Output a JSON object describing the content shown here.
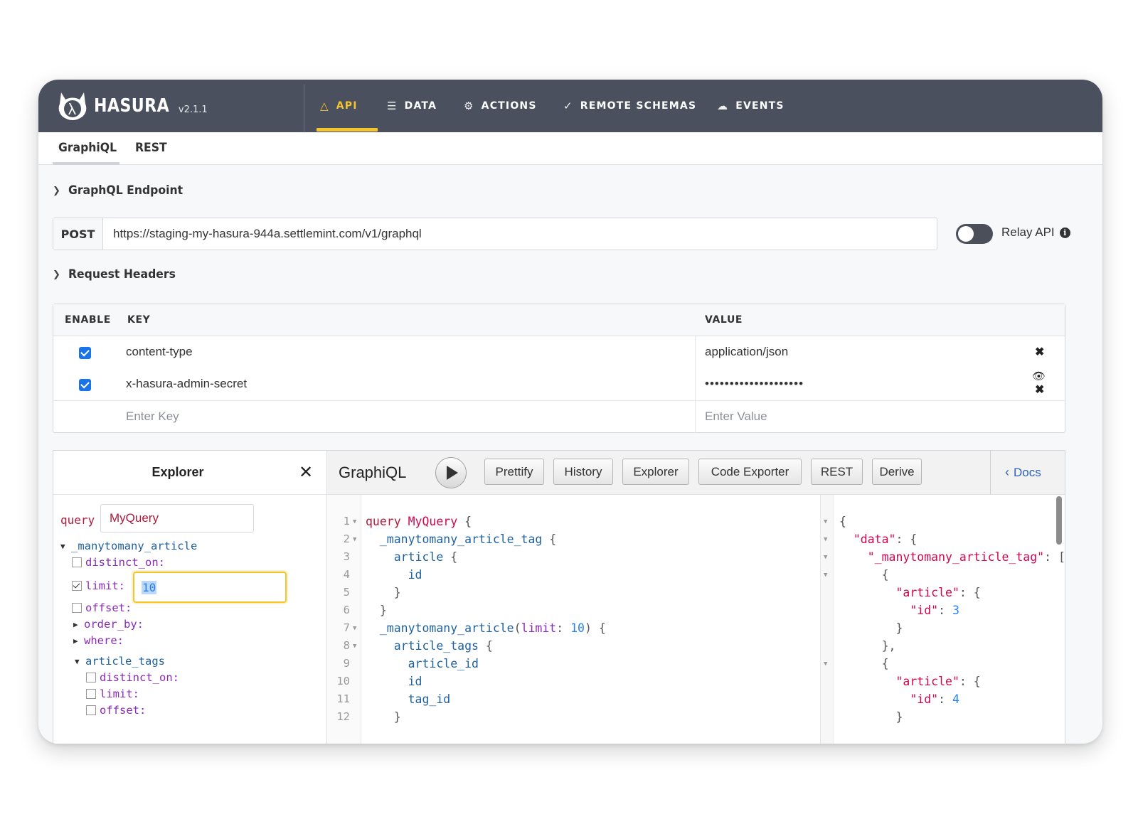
{
  "brand": {
    "name": "HASURA",
    "version": "v2.1.1"
  },
  "nav": [
    {
      "label": "API",
      "icon": "flask-icon",
      "active": true
    },
    {
      "label": "DATA",
      "icon": "database-icon",
      "active": false
    },
    {
      "label": "ACTIONS",
      "icon": "gears-icon",
      "active": false
    },
    {
      "label": "REMOTE SCHEMAS",
      "icon": "plug-icon",
      "active": false
    },
    {
      "label": "EVENTS",
      "icon": "cloud-icon",
      "active": false
    }
  ],
  "subtabs": [
    {
      "label": "GraphiQL",
      "active": true
    },
    {
      "label": "REST",
      "active": false
    }
  ],
  "endpoint": {
    "section_title": "GraphQL Endpoint",
    "method": "POST",
    "url": "https://staging-my-hasura-944a.settlemint.com/v1/graphql",
    "relay_label": "Relay API",
    "relay_enabled": false
  },
  "headers": {
    "section_title": "Request Headers",
    "columns": {
      "enable": "ENABLE",
      "key": "KEY",
      "value": "VALUE"
    },
    "rows": [
      {
        "enabled": true,
        "key": "content-type",
        "value": "application/json"
      },
      {
        "enabled": true,
        "key": "x-hasura-admin-secret",
        "value": "••••••••••••••••••••"
      }
    ],
    "placeholder_key": "Enter Key",
    "placeholder_value": "Enter Value"
  },
  "explorer": {
    "title": "Explorer",
    "query_label": "query",
    "query_name": "MyQuery",
    "tree": {
      "root": "_manytomany_article",
      "distinct_on": "distinct_on:",
      "limit": "limit:",
      "limit_value": "10",
      "offset": "offset:",
      "order_by": "order_by:",
      "where": "where:",
      "article_tags": "article_tags",
      "sub_distinct_on": "distinct_on:",
      "sub_limit": "limit:",
      "sub_offset": "offset:"
    }
  },
  "toolbar": {
    "title": "GraphiQL",
    "buttons": [
      "Prettify",
      "History",
      "Explorer",
      "Code Exporter",
      "REST",
      "Derive"
    ],
    "docs": "Docs"
  },
  "editor": {
    "line_numbers": [
      "1",
      "2",
      "3",
      "4",
      "5",
      "6",
      "7",
      "8",
      "9",
      "10",
      "11",
      "12"
    ],
    "query_keyword": "query",
    "query_name": "MyQuery",
    "f_article_tag": "_manytomany_article_tag",
    "f_article": "article",
    "f_id": "id",
    "f_article_root": "_manytomany_article",
    "arg_limit": "limit",
    "arg_value": "10",
    "f_article_tags": "article_tags",
    "f_article_id": "article_id",
    "f_tag_id": "tag_id"
  },
  "result": {
    "k_data": "\"data\"",
    "k_tag": "\"_manytomany_article_tag\"",
    "k_article": "\"article\"",
    "k_id": "\"id\"",
    "v_id_1": "3",
    "v_id_2": "4"
  },
  "colors": {
    "nav_bg": "#4a505e",
    "accent": "#f6c42f",
    "checkbox": "#1a73e8",
    "keyword": "#b11a3b",
    "field": "#1f61a0",
    "number": "#2882f9"
  }
}
